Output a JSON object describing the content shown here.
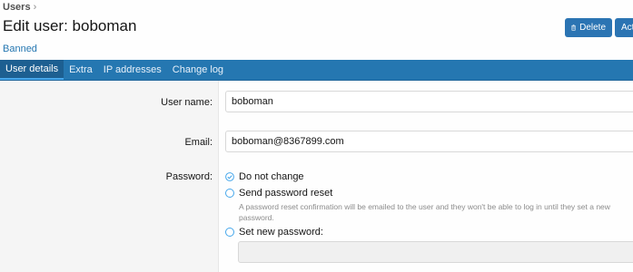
{
  "breadcrumb": {
    "item": "Users",
    "sep": "›"
  },
  "page": {
    "title": "Edit user: boboman",
    "status_link": "Banned"
  },
  "actions": {
    "delete_label": "Delete",
    "actions_label": "Act"
  },
  "tabs": [
    {
      "label": "User details",
      "active": true
    },
    {
      "label": "Extra",
      "active": false
    },
    {
      "label": "IP addresses",
      "active": false
    },
    {
      "label": "Change log",
      "active": false
    }
  ],
  "form": {
    "username_label": "User name:",
    "username_value": "boboman",
    "email_label": "Email:",
    "email_value": "boboman@8367899.com",
    "password_label": "Password:",
    "password_options": {
      "no_change": "Do not change",
      "send_reset": "Send password reset",
      "send_reset_hint": "A password reset confirmation will be emailed to the user and they won't be able to log in until they set a new password.",
      "set_new": "Set new password:"
    },
    "new_password_value": ""
  },
  "colors": {
    "accent": "#2577b1",
    "tab_active": "#1d5f91",
    "button": "#2b74b3"
  }
}
